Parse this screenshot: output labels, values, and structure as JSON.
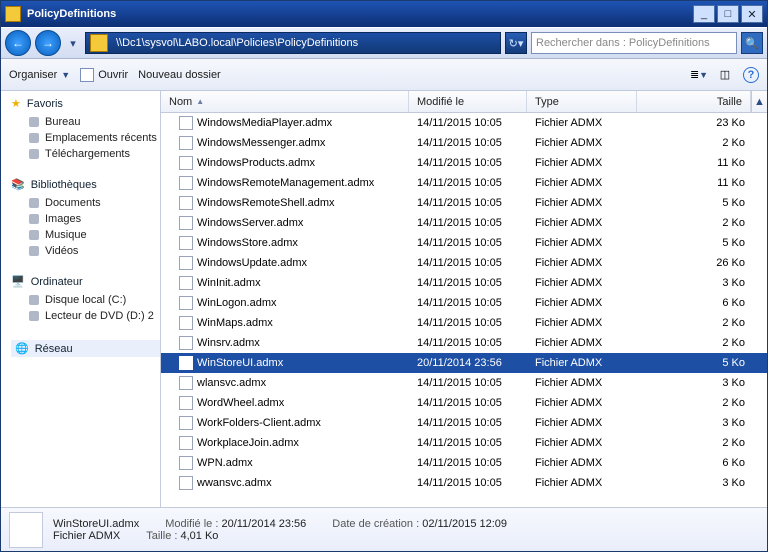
{
  "window": {
    "title": "PolicyDefinitions"
  },
  "nav": {
    "back": "←",
    "forward": "→",
    "dropdown": "▾"
  },
  "address": {
    "crumbs": [
      "\\\\Dc1\\sysvol\\LABO.local\\Policies\\PolicyDefinitions"
    ],
    "refresh": "↻"
  },
  "search": {
    "placeholder": "Rechercher dans : PolicyDefinitions",
    "go": "🔍"
  },
  "toolbar": {
    "organiser": "Organiser",
    "ouvrir": "Ouvrir",
    "nouveau_dossier": "Nouveau dossier"
  },
  "sidebar": {
    "favoris": {
      "label": "Favoris",
      "items": [
        "Bureau",
        "Emplacements récents",
        "Téléchargements"
      ]
    },
    "biblio": {
      "label": "Bibliothèques",
      "items": [
        "Documents",
        "Images",
        "Musique",
        "Vidéos"
      ]
    },
    "ordi": {
      "label": "Ordinateur",
      "items": [
        "Disque local (C:)",
        "Lecteur de DVD (D:) 2"
      ]
    },
    "reseau": {
      "label": "Réseau"
    }
  },
  "columns": {
    "nom": "Nom",
    "modifie": "Modifié le",
    "type": "Type",
    "taille": "Taille"
  },
  "files": [
    {
      "name": "WindowsMediaPlayer.admx",
      "date": "14/11/2015 10:05",
      "type": "Fichier ADMX",
      "size": "23 Ko"
    },
    {
      "name": "WindowsMessenger.admx",
      "date": "14/11/2015 10:05",
      "type": "Fichier ADMX",
      "size": "2 Ko"
    },
    {
      "name": "WindowsProducts.admx",
      "date": "14/11/2015 10:05",
      "type": "Fichier ADMX",
      "size": "11 Ko"
    },
    {
      "name": "WindowsRemoteManagement.admx",
      "date": "14/11/2015 10:05",
      "type": "Fichier ADMX",
      "size": "11 Ko"
    },
    {
      "name": "WindowsRemoteShell.admx",
      "date": "14/11/2015 10:05",
      "type": "Fichier ADMX",
      "size": "5 Ko"
    },
    {
      "name": "WindowsServer.admx",
      "date": "14/11/2015 10:05",
      "type": "Fichier ADMX",
      "size": "2 Ko"
    },
    {
      "name": "WindowsStore.admx",
      "date": "14/11/2015 10:05",
      "type": "Fichier ADMX",
      "size": "5 Ko"
    },
    {
      "name": "WindowsUpdate.admx",
      "date": "14/11/2015 10:05",
      "type": "Fichier ADMX",
      "size": "26 Ko"
    },
    {
      "name": "WinInit.admx",
      "date": "14/11/2015 10:05",
      "type": "Fichier ADMX",
      "size": "3 Ko"
    },
    {
      "name": "WinLogon.admx",
      "date": "14/11/2015 10:05",
      "type": "Fichier ADMX",
      "size": "6 Ko"
    },
    {
      "name": "WinMaps.admx",
      "date": "14/11/2015 10:05",
      "type": "Fichier ADMX",
      "size": "2 Ko"
    },
    {
      "name": "Winsrv.admx",
      "date": "14/11/2015 10:05",
      "type": "Fichier ADMX",
      "size": "2 Ko"
    },
    {
      "name": "WinStoreUI.admx",
      "date": "20/11/2014 23:56",
      "type": "Fichier ADMX",
      "size": "5 Ko",
      "sel": true
    },
    {
      "name": "wlansvc.admx",
      "date": "14/11/2015 10:05",
      "type": "Fichier ADMX",
      "size": "3 Ko"
    },
    {
      "name": "WordWheel.admx",
      "date": "14/11/2015 10:05",
      "type": "Fichier ADMX",
      "size": "2 Ko"
    },
    {
      "name": "WorkFolders-Client.admx",
      "date": "14/11/2015 10:05",
      "type": "Fichier ADMX",
      "size": "3 Ko"
    },
    {
      "name": "WorkplaceJoin.admx",
      "date": "14/11/2015 10:05",
      "type": "Fichier ADMX",
      "size": "2 Ko"
    },
    {
      "name": "WPN.admx",
      "date": "14/11/2015 10:05",
      "type": "Fichier ADMX",
      "size": "6 Ko"
    },
    {
      "name": "wwansvc.admx",
      "date": "14/11/2015 10:05",
      "type": "Fichier ADMX",
      "size": "3 Ko"
    }
  ],
  "details": {
    "name": "WinStoreUI.admx",
    "type": "Fichier ADMX",
    "mod_label": "Modifié le :",
    "mod_value": "20/11/2014 23:56",
    "size_label": "Taille :",
    "size_value": "4,01 Ko",
    "created_label": "Date de création :",
    "created_value": "02/11/2015 12:09"
  }
}
